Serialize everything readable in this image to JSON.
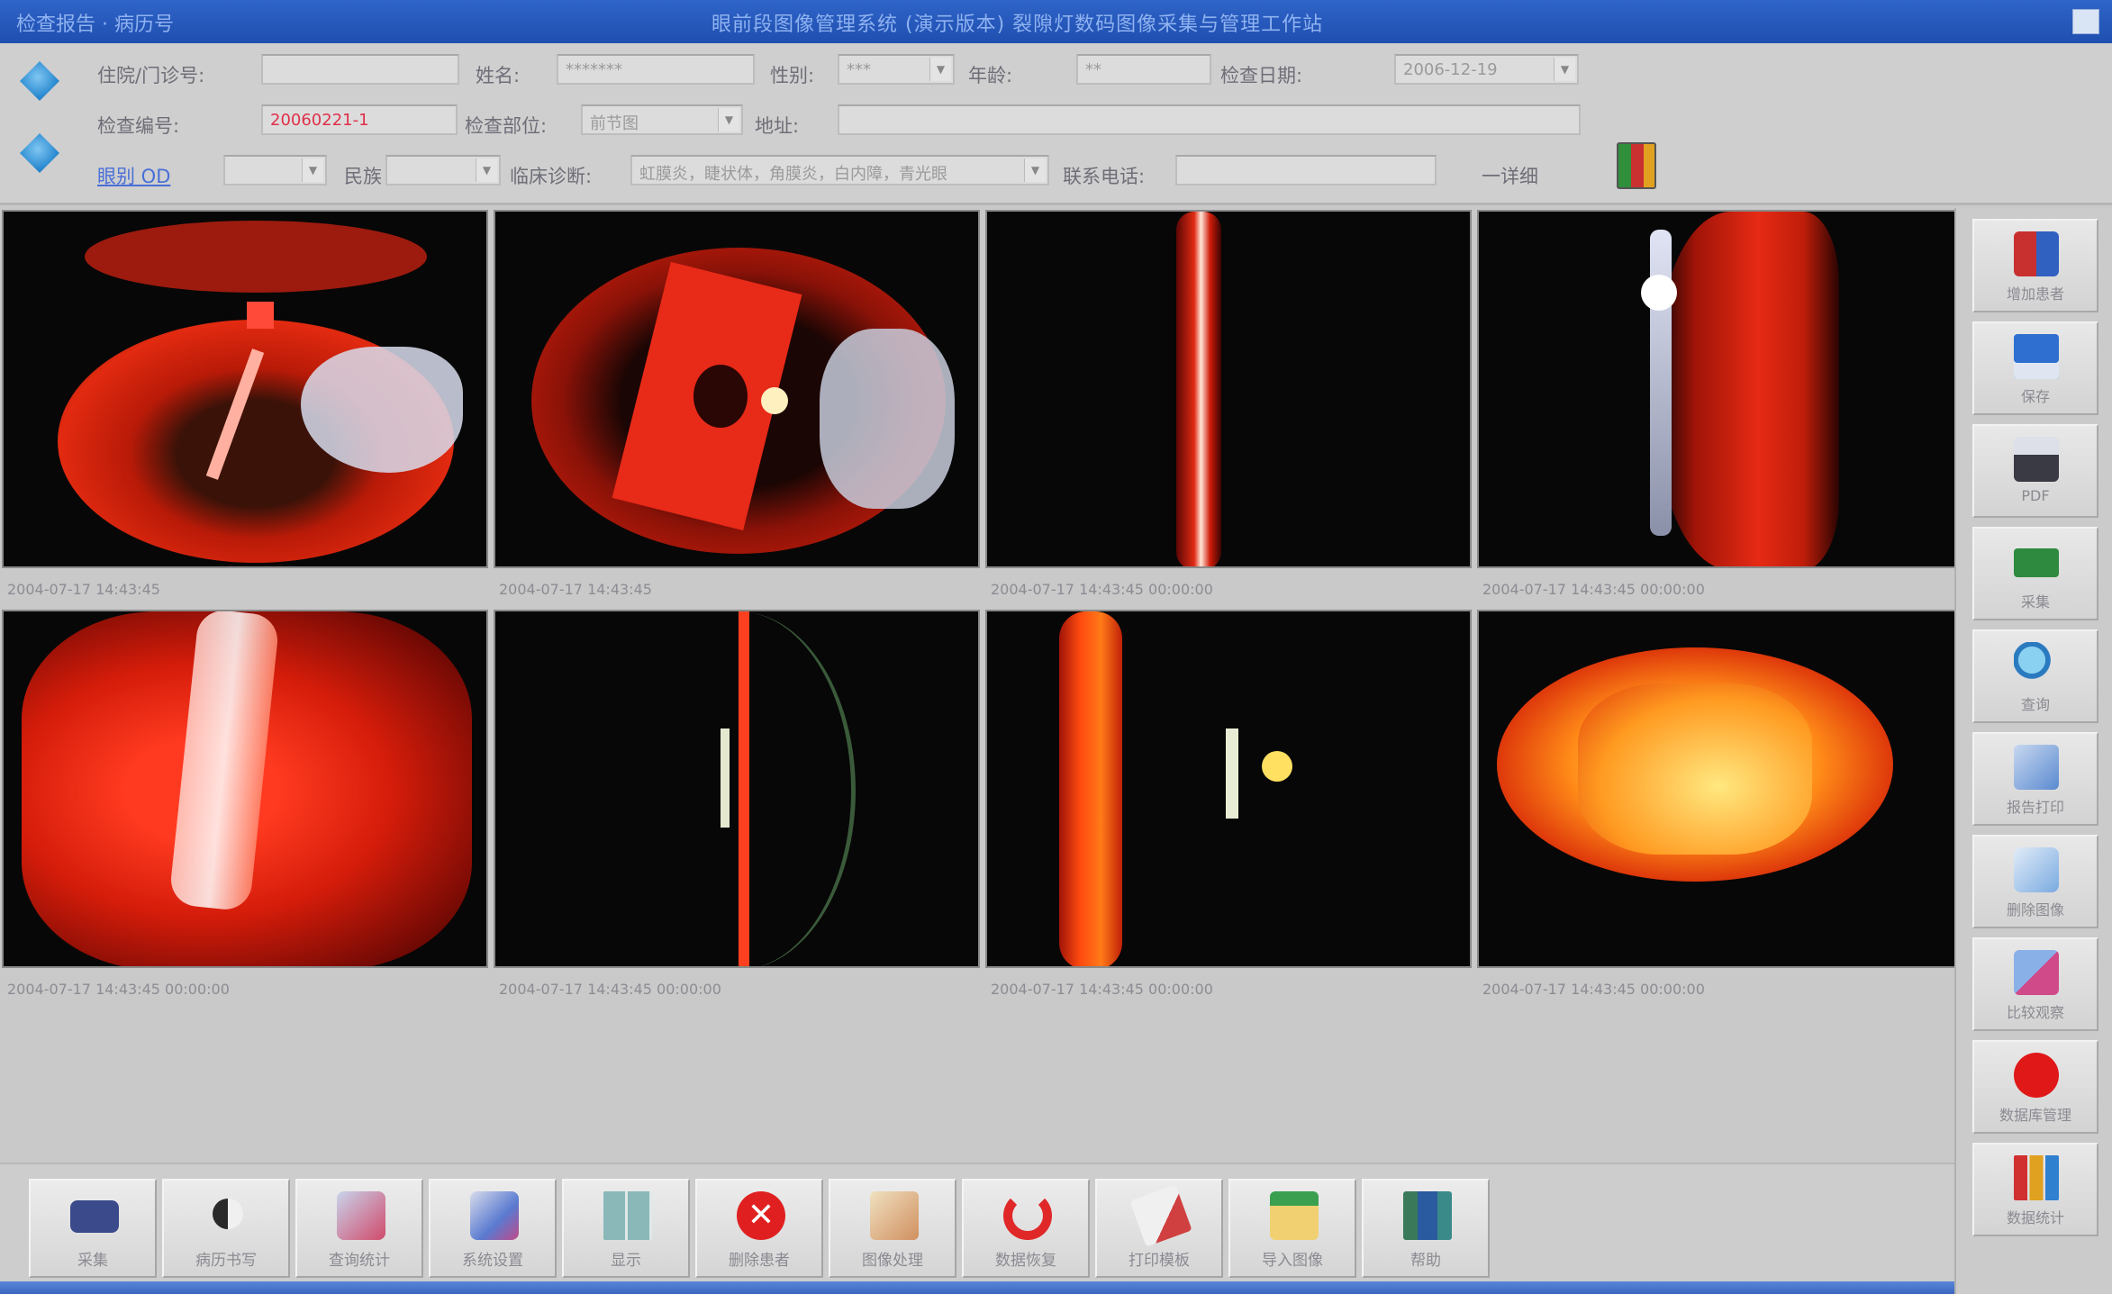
{
  "window": {
    "app_title": "检查报告 · 病历号",
    "center_title": "眼前段图像管理系统  (演示版本)  裂隙灯数码图像采集与管理工作站"
  },
  "patient": {
    "outpatient_no_label": "住院/门诊号:",
    "outpatient_no_value": "",
    "name_label": "姓名:",
    "name_value": "*******",
    "gender_label": "性别:",
    "gender_value": "***",
    "age_label": "年龄:",
    "age_value": "**",
    "exam_date_label": "检查日期:",
    "exam_date_value": "2006-12-19",
    "exam_no_label": "检查编号:",
    "exam_no_value": "20060221-1",
    "exam_method_label": "检查部位:",
    "exam_method_value": "前节图",
    "address_label": "地址:",
    "address_value": "",
    "eye_label": "眼别 OD",
    "eye_value": "",
    "nation_label": "民族",
    "nation_value": "",
    "clinical_dx_label": "临床诊断:",
    "clinical_dx_value": "虹膜炎，睫状体，角膜炎，白内障，青光眼",
    "phone_label": "联系电话:",
    "phone_value": "",
    "other_label": "一详细"
  },
  "images": [
    {
      "timestamp": "2004-07-17 14:43:45"
    },
    {
      "timestamp": "2004-07-17 14:43:45"
    },
    {
      "timestamp": "2004-07-17 14:43:45 00:00:00"
    },
    {
      "timestamp": "2004-07-17 14:43:45 00:00:00"
    },
    {
      "timestamp": "2004-07-17 14:43:45 00:00:00"
    },
    {
      "timestamp": "2004-07-17 14:43:45 00:00:00"
    },
    {
      "timestamp": "2004-07-17 14:43:45 00:00:00"
    },
    {
      "timestamp": "2004-07-17 14:43:45 00:00:00"
    }
  ],
  "right_toolbar": [
    {
      "label": "增加患者",
      "icon": "add-patient-icon"
    },
    {
      "label": "保存",
      "icon": "save-disk-icon"
    },
    {
      "label": "PDF",
      "icon": "pdf-icon"
    },
    {
      "label": "采集",
      "icon": "capture-icon"
    },
    {
      "label": "查询",
      "icon": "search-icon"
    },
    {
      "label": "报告打印",
      "icon": "print-report-icon"
    },
    {
      "label": "删除图像",
      "icon": "delete-image-icon"
    },
    {
      "label": "比较观察",
      "icon": "compare-icon"
    },
    {
      "label": "数据库管理",
      "icon": "record-icon"
    },
    {
      "label": "数据统计",
      "icon": "statistics-icon"
    }
  ],
  "bottom_toolbar": [
    {
      "label": "采集",
      "icon": "camera-icon"
    },
    {
      "label": "病历书写",
      "icon": "half-circle-icon"
    },
    {
      "label": "查询统计",
      "icon": "query-stats-icon"
    },
    {
      "label": "系统设置",
      "icon": "settings-icon"
    },
    {
      "label": "显示",
      "icon": "grid-view-icon"
    },
    {
      "label": "删除患者",
      "icon": "delete-patient-icon"
    },
    {
      "label": "图像处理",
      "icon": "image-process-icon"
    },
    {
      "label": "数据恢复",
      "icon": "recycle-icon"
    },
    {
      "label": "打印模板",
      "icon": "print-template-icon"
    },
    {
      "label": "导入图像",
      "icon": "import-image-icon"
    },
    {
      "label": "帮助",
      "icon": "help-book-icon"
    }
  ],
  "colors": {
    "titlebar": "#2f64c8",
    "panel": "#cfcfcf",
    "accent_red": "#e0304a"
  }
}
